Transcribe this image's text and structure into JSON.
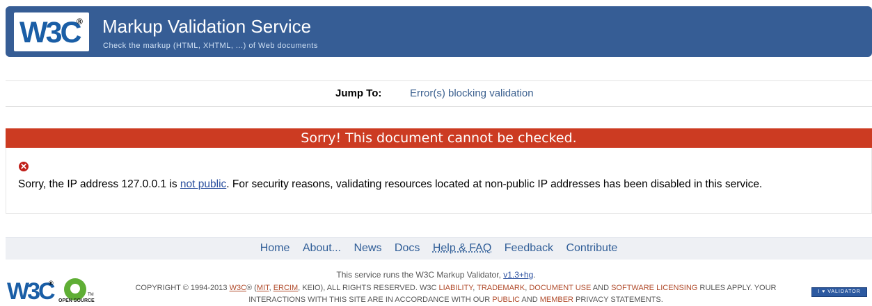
{
  "header": {
    "logo_text": "W3C",
    "logo_reg": "®",
    "title": "Markup Validation Service",
    "subtitle": "Check the markup (HTML, XHTML, ...) of Web documents"
  },
  "jump": {
    "label": "Jump To:",
    "link": "Error(s) blocking validation"
  },
  "error": {
    "heading": "Sorry! This document cannot be checked.",
    "icon": "error-x-icon",
    "icon_glyph": "✕",
    "message_before": "Sorry, the IP address 127.0.0.1 is ",
    "message_link": "not public",
    "message_after": ". For security reasons, validating resources located at non-public IP addresses has been disabled in this service."
  },
  "footer_nav": {
    "items": [
      "Home",
      "About...",
      "News",
      "Docs",
      "Help & FAQ",
      "Feedback",
      "Contribute"
    ]
  },
  "footer": {
    "runs_before": "This service runs the W3C Markup Validator, ",
    "runs_link": "v1.3+hg",
    "runs_after": ".",
    "copyright_line1_a": "COPYRIGHT © 1994-2013 ",
    "copyright_w3c": "W3C",
    "copyright_line1_b": "® (",
    "copyright_mit": "MIT",
    "copyright_sep1": ", ",
    "copyright_ercim": "ERCIM",
    "copyright_line1_c": ", KEIO), ALL RIGHTS RESERVED. W3C ",
    "liability": "LIABILITY",
    "comma1": ", ",
    "trademark": "TRADEMARK",
    "comma2": ", ",
    "doc_use": "DOCUMENT USE",
    "and1": " AND ",
    "software_licensing": "SOFTWARE LICENSING",
    "rules": " RULES APPLY. YOUR",
    "line2_a": "INTERACTIONS WITH THIS SITE ARE IN ACCORDANCE WITH OUR ",
    "public": "PUBLIC",
    "and2": " AND ",
    "member": "MEMBER",
    "line2_b": " PRIVACY STATEMENTS.",
    "w3c_logo": "W3C",
    "w3c_logo_reg": "®",
    "opensource_label": "OPEN SOURCE",
    "opensource_tm": "TM",
    "badge": "I ♥ VALIDATOR"
  },
  "colors": {
    "banner": "#365d95",
    "error_header": "#cc3b22",
    "link": "#3a5f8e"
  }
}
